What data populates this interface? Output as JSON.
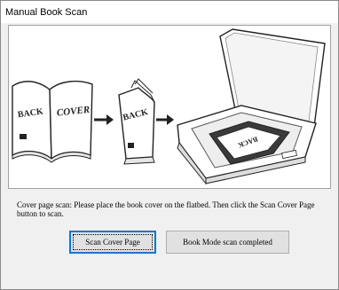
{
  "window": {
    "title": "Manual Book Scan"
  },
  "illustration": {
    "book_front_texts": [
      "BACK",
      "COVER"
    ],
    "book_back_text": "BACK",
    "book_on_scanner_text": "BACK"
  },
  "instruction_text": "Cover page scan: Please place the book cover on the flatbed. Then click the Scan Cover Page button to scan.",
  "buttons": {
    "scan_cover_label": "Scan Cover Page",
    "book_mode_done_label": "Book Mode scan completed"
  }
}
